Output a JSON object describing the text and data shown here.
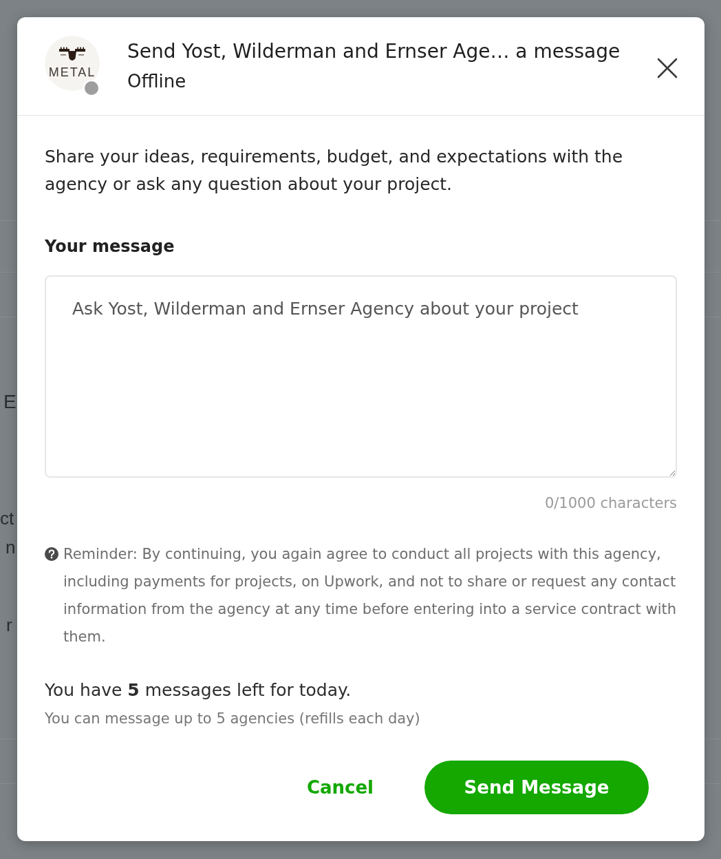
{
  "background": {
    "fragments": [
      "E",
      "ct",
      "n",
      "r"
    ]
  },
  "dialog": {
    "avatar": {
      "logo_text": "METAL",
      "online": false
    },
    "title": "Send Yost, Wilderman and Ernser Age… a message",
    "status": "Offline"
  },
  "intro": "Share your ideas, requirements, budget, and expectations with the agency or ask any question about your project.",
  "message_field": {
    "label": "Your message",
    "placeholder": "Ask Yost, Wilderman and Ernser Agency about your project",
    "counter": "0/1000 characters"
  },
  "reminder": "Reminder: By continuing, you again agree to conduct all projects with this agency, including payments for projects, on Upwork, and not to share or request any contact information from the agency at any time before entering into a service contract with them.",
  "quota": {
    "summary": "You have **5** messages left for today.",
    "note": "You can message up to 5 agencies (refills each day)"
  },
  "buttons": [
    {
      "label": "Cancel",
      "kind": "secondary"
    },
    {
      "label": "Send Message",
      "kind": "primary"
    }
  ]
}
